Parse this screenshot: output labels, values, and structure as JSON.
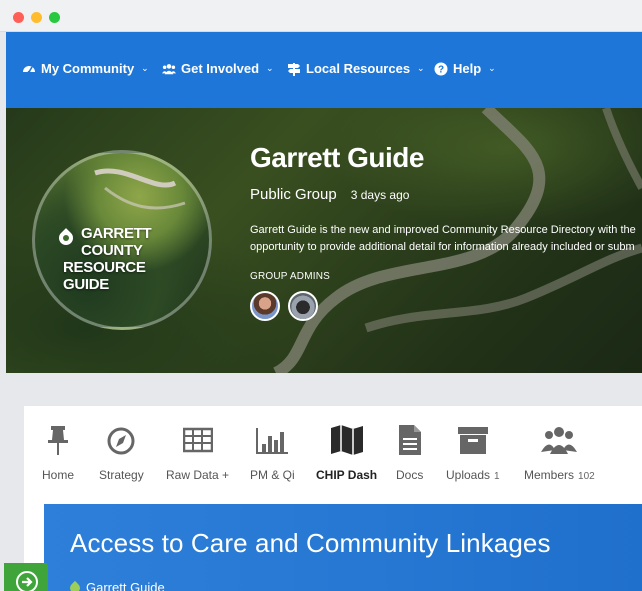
{
  "nav": {
    "items": [
      {
        "label": "My Community",
        "icon": "dashboard-icon"
      },
      {
        "label": "Get Involved",
        "icon": "users-icon"
      },
      {
        "label": "Local Resources",
        "icon": "signpost-icon"
      },
      {
        "label": "Help",
        "icon": "question-circle-icon"
      }
    ]
  },
  "group": {
    "logo_line1": "GARRETT COUNTY",
    "logo_line2": "RESOURCE GUIDE",
    "title": "Garrett Guide",
    "type": "Public Group",
    "age": "3 days ago",
    "desc_line1": "Garrett Guide is the new and improved Community Resource Directory with the",
    "desc_line2": "opportunity to provide additional detail for information already included or subm",
    "admins_label": "GROUP ADMINS"
  },
  "tabs": [
    {
      "label": "Home",
      "icon": "pushpin-icon"
    },
    {
      "label": "Strategy",
      "icon": "compass-icon"
    },
    {
      "label": "Raw Data +",
      "icon": "table-icon"
    },
    {
      "label": "PM & Qi",
      "icon": "bar-chart-icon"
    },
    {
      "label": "CHIP Dash",
      "icon": "map-icon"
    },
    {
      "label": "Docs",
      "icon": "document-icon"
    },
    {
      "label": "Uploads",
      "icon": "archive-icon",
      "count": "1"
    },
    {
      "label": "Members",
      "icon": "group-icon",
      "count": "102"
    }
  ],
  "banner": {
    "title": "Access to Care and Community Linkages",
    "sub": "Garrett Guide"
  },
  "colors": {
    "nav_bg": "#1e77d8",
    "banner_bg": "#2578d4",
    "float_btn": "#3fa53a"
  }
}
